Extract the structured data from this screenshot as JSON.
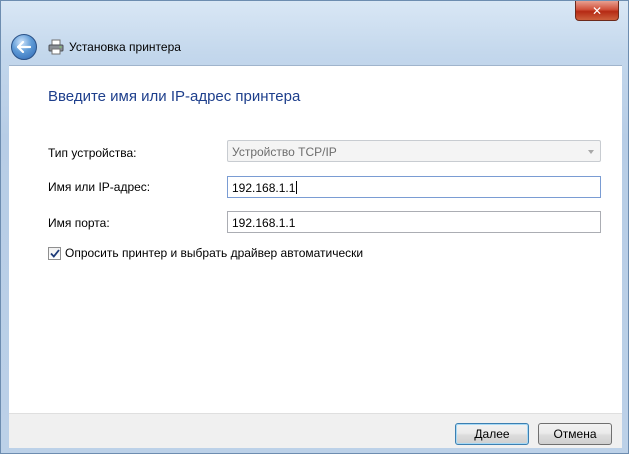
{
  "window": {
    "title": "Установка принтера",
    "close_symbol": "✕"
  },
  "content": {
    "heading": "Введите имя или IP-адрес принтера",
    "device_type": {
      "label": "Тип устройства:",
      "value": "Устройство TCP/IP"
    },
    "hostname": {
      "label": "Имя или IP-адрес:",
      "value": "192.168.1.1"
    },
    "port_name": {
      "label": "Имя порта:",
      "value": "192.168.1.1"
    },
    "query_printer": {
      "label": "Опросить принтер и выбрать драйвер автоматически",
      "checked": true
    }
  },
  "buttons": {
    "next": "Далее",
    "cancel": "Отмена"
  },
  "icons": {
    "back": "back-arrow-icon",
    "printer": "printer-icon",
    "close": "close-icon"
  },
  "colors": {
    "heading": "#1e3f8c",
    "close_button": "#c4422a",
    "focus_border": "#7a9cd3"
  }
}
